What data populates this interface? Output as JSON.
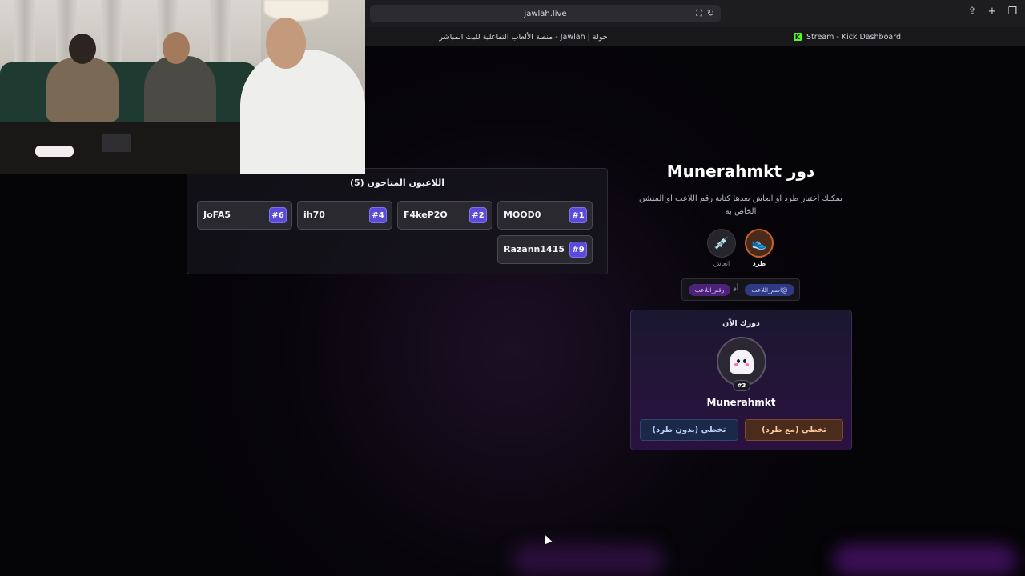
{
  "browser": {
    "url": "jawlah.live",
    "tabs": [
      {
        "label": "جولة | Jawlah - منصة الألعاب التفاعلية للبث المباشر"
      },
      {
        "label": "Stream - Kick Dashboard"
      }
    ]
  },
  "players_panel": {
    "title": "اللاعبون المتاحون (5)",
    "players": [
      {
        "name": "JoFA5",
        "number": "#6"
      },
      {
        "name": "ih70",
        "number": "#4"
      },
      {
        "name": "F4keP2O",
        "number": "#2"
      },
      {
        "name": "MOOD0",
        "number": "#1"
      },
      {
        "name": "Razann1415",
        "number": "#9"
      }
    ]
  },
  "turn": {
    "title": "دور Munerahmkt",
    "description": "يمكنك اختيار طرد او انعاش بعدها كتابة رقم اللاعب او المنشن الخاص به",
    "actions": {
      "kick": {
        "label": "طرد",
        "icon": "shoe-icon"
      },
      "revive": {
        "label": "انعاش",
        "icon": "syringe-icon"
      }
    },
    "format": {
      "mention": "@اسم_اللاعب",
      "or": "أو",
      "number": "رقم_اللاعب"
    }
  },
  "current": {
    "label": "دورك الآن",
    "name": "Munerahmkt",
    "number": "#3",
    "skip_with_kick": "تخطي (مع طرد)",
    "skip_without_kick": "تخطي (بدون طرد)"
  },
  "colors": {
    "accent_purple": "#5b4bd8",
    "kick_orange": "#c8602a",
    "kick_green": "#53fc18"
  }
}
